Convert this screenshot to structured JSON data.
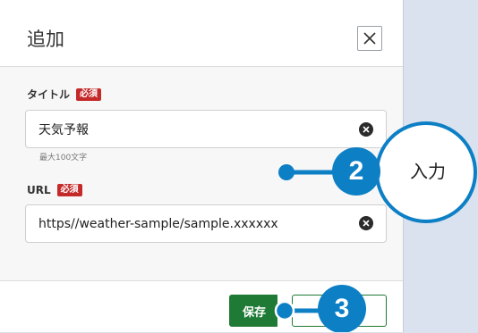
{
  "dialog": {
    "title": "追加",
    "close_icon": "close-icon"
  },
  "fields": {
    "title": {
      "label": "タイトル",
      "required_badge": "必須",
      "value": "天気予報",
      "helper": "最大100文字"
    },
    "url": {
      "label": "URL",
      "required_badge": "必須",
      "value": "https//weather-sample/sample.xxxxxx"
    }
  },
  "footer": {
    "save_label": "保存",
    "cancel_label": ""
  },
  "annotations": {
    "step2_number": "2",
    "step2_bubble_text": "入力",
    "step3_number": "3",
    "accent_color": "#0d7fc5"
  }
}
